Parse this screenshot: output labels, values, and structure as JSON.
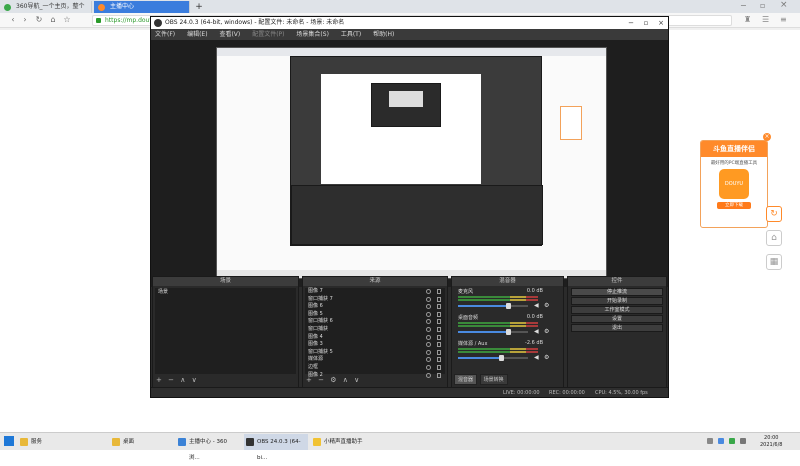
{
  "browser": {
    "tabs": [
      {
        "label": "360导航_一个主页，整个世界",
        "active": false
      },
      {
        "label": "主播中心",
        "active": true
      }
    ],
    "new_tab": "+",
    "address": "https://mp.douyu.co",
    "nav": {
      "back": "‹",
      "forward": "›",
      "reload": "↻",
      "home": "⌂",
      "star": "☆"
    }
  },
  "obs": {
    "title": "OBS 24.0.3 (64-bit, windows) - 配置文件: 未命名 - 场景: 未命名",
    "menu": [
      "文件(F)",
      "编辑(E)",
      "查看(V)",
      "配置文件(P)",
      "场景集合(S)",
      "工具(T)",
      "帮助(H)"
    ],
    "docks": {
      "scenes": {
        "title": "场景",
        "items": [
          "场景"
        ],
        "footer": [
          "+",
          "−",
          "∧",
          "∨"
        ]
      },
      "sources": {
        "title": "来源",
        "items": [
          "图像 7",
          "窗口捕获 7",
          "图像 6",
          "图像 5",
          "窗口捕获 6",
          "窗口捕获",
          "图像 4",
          "图像 3",
          "窗口捕获 5",
          "媒体源",
          "边框",
          "图像 2"
        ],
        "footer": [
          "+",
          "−",
          "⚙",
          "∧",
          "∨"
        ]
      },
      "mixer": {
        "title": "混音器",
        "channels": [
          {
            "name": "麦克风",
            "db": "0.0 dB",
            "level": 0.72
          },
          {
            "name": "桌面音频",
            "db": "0.0 dB",
            "level": 0.72
          },
          {
            "name": "媒体源 / Aux",
            "db": "-2.6 dB",
            "level": 0.62
          }
        ],
        "tabs": [
          "混音器",
          "场景转换"
        ]
      },
      "controls": {
        "title": "控件",
        "buttons": [
          "停止推流",
          "开始录制",
          "工作室模式",
          "设置",
          "退出"
        ]
      }
    },
    "status": {
      "live": "LIVE: 00:00:00",
      "rec": "REC: 00:00:00",
      "cpu": "CPU: 4.5%, 30.00 fps"
    }
  },
  "ad": {
    "title": "斗鱼直播伴侣",
    "subtitle": "最好用的PC端直播工具",
    "logo": "DOUYU",
    "button": "立即下载",
    "close": "×"
  },
  "sidebar_buttons": [
    "↻",
    "⌂",
    "▦"
  ],
  "taskbar": {
    "items": [
      {
        "label": "服务",
        "color": "#e8b839",
        "active": false
      },
      {
        "label": "桌面",
        "color": "#e8b839",
        "active": false
      },
      {
        "label": "主播中心 - 360浏...",
        "color": "#3b82d6",
        "active": false
      },
      {
        "label": "OBS 24.0.3 (64-bi...",
        "color": "#333333",
        "active": true
      },
      {
        "label": "小精声直播助手",
        "color": "#f1c232",
        "active": false
      }
    ],
    "clock_time": "20:00",
    "clock_date": "2021/6/8"
  }
}
